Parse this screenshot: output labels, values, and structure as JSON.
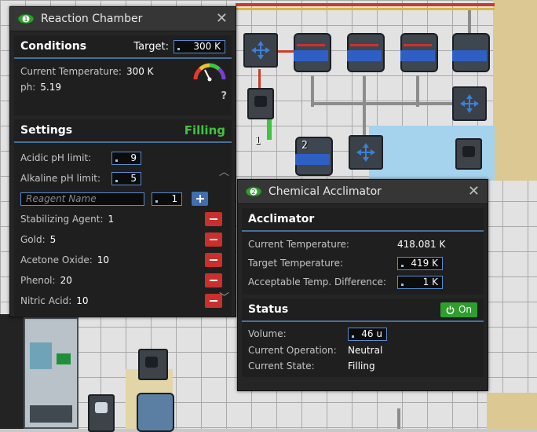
{
  "reaction_chamber": {
    "badge": "1",
    "title": "Reaction Chamber",
    "close_glyph": "✕",
    "conditions": {
      "heading": "Conditions",
      "target_label": "Target:",
      "target_value": "300 K",
      "temp_label": "Current Temperature:",
      "temp_value": "300 K",
      "ph_label": "ph:",
      "ph_value": "5.19",
      "help_glyph": "?",
      "gauge_icon": "gauge-icon"
    },
    "settings": {
      "heading": "Settings",
      "status": "Filling",
      "acidic_label": "Acidic pH limit:",
      "acidic_value": "9",
      "alkaline_label": "Alkaline pH limit:",
      "alkaline_value": "5",
      "reagent_placeholder": "Reagent Name",
      "reagent_amount": "1",
      "reagents": [
        {
          "name": "Stabilizing Agent:",
          "amount": "1"
        },
        {
          "name": "Gold:",
          "amount": "5"
        },
        {
          "name": "Acetone Oxide:",
          "amount": "10"
        },
        {
          "name": "Phenol:",
          "amount": "20"
        },
        {
          "name": "Nitric Acid:",
          "amount": "10"
        }
      ]
    }
  },
  "acclimator": {
    "badge": "2",
    "title": "Chemical Acclimator",
    "close_glyph": "✕",
    "section": {
      "heading": "Acclimator",
      "current_temp_label": "Current Temperature:",
      "current_temp_value": "418.081 K",
      "target_temp_label": "Target Temperature:",
      "target_temp_value": "419 K",
      "diff_label": "Acceptable Temp. Difference:",
      "diff_value": "1 K"
    },
    "status": {
      "heading": "Status",
      "power_label": "On",
      "volume_label": "Volume:",
      "volume_value": "46 u",
      "operation_label": "Current Operation:",
      "operation_value": "Neutral",
      "state_label": "Current State:",
      "state_value": "Filling"
    }
  },
  "map_labels": {
    "label_1": "1",
    "label_2": "2"
  },
  "colors": {
    "accent_green": "#3ec43e",
    "accent_blue": "#4a6f99",
    "danger_red": "#c9302c",
    "on_green": "#2f9e2f"
  }
}
